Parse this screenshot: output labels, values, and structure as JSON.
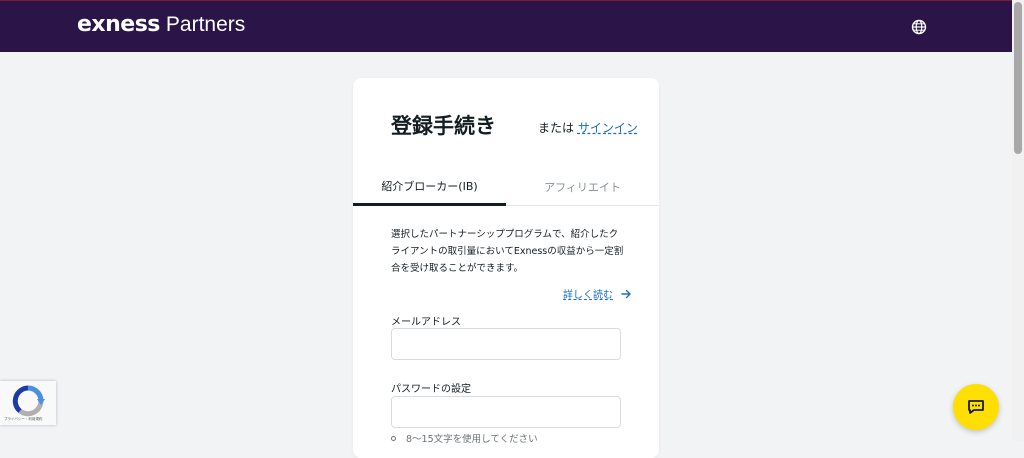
{
  "header": {
    "brand": "exness",
    "brand_sub": "Partners"
  },
  "card": {
    "title": "登録手続き",
    "or_text": "または",
    "signin_link": "サインイン",
    "tabs": [
      {
        "label": "紹介ブローカー(IB)",
        "active": true
      },
      {
        "label": "アフィリエイト",
        "active": false
      }
    ],
    "description": "選択したパートナーシッププログラムで、紹介したクライアントの取引量においてExnessの収益から一定割合を受け取ることができます。",
    "learn_more": "詳しく読む",
    "email_label": "メールアドレス",
    "email_value": "",
    "password_label": "パスワードの設定",
    "password_value": "",
    "password_hint": "8～15文字を使用してください"
  },
  "recaptcha": {
    "text": "プライバシー・利用規約"
  },
  "colors": {
    "header_bg": "#2b1548",
    "link": "#1b6ec2",
    "chat_button": "#ffde02",
    "page_bg": "#f2f3f5"
  },
  "icons": {
    "language": "globe-icon",
    "learn_more": "arrow-right-icon",
    "chat": "chat-bubble-icon",
    "recaptcha": "recaptcha-logo-icon"
  }
}
